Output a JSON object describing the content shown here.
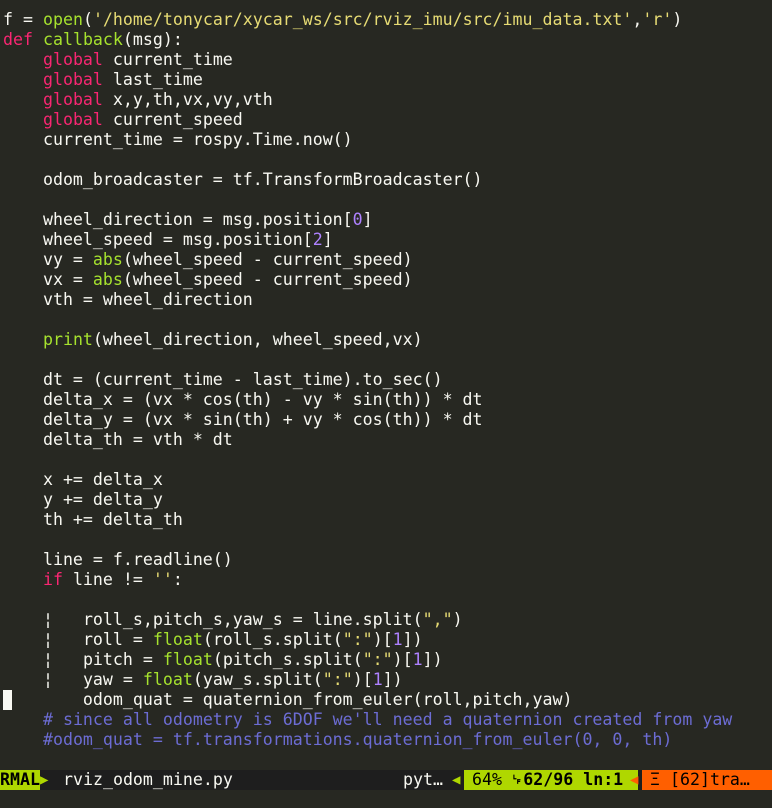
{
  "code_lines": [
    [
      [
        "t",
        "f = "
      ],
      [
        "bi",
        "open"
      ],
      [
        "t",
        "("
      ],
      [
        "st",
        "'/home/tonycar/xycar_ws/src/rviz_imu/src/imu_data.txt'"
      ],
      [
        "t",
        ","
      ],
      [
        "st",
        "'r'"
      ],
      [
        "t",
        ")"
      ]
    ],
    [
      [
        "kw",
        "def"
      ],
      [
        "t",
        " "
      ],
      [
        "bi",
        "callback"
      ],
      [
        "t",
        "(msg):"
      ]
    ],
    [
      [
        "t",
        "    "
      ],
      [
        "kw",
        "global"
      ],
      [
        "t",
        " current_time"
      ]
    ],
    [
      [
        "t",
        "    "
      ],
      [
        "kw",
        "global"
      ],
      [
        "t",
        " last_time"
      ]
    ],
    [
      [
        "t",
        "    "
      ],
      [
        "kw",
        "global"
      ],
      [
        "t",
        " x,y,th,vx,vy,vth"
      ]
    ],
    [
      [
        "t",
        "    "
      ],
      [
        "kw",
        "global"
      ],
      [
        "t",
        " current_speed"
      ]
    ],
    [
      [
        "t",
        "    current_time = rospy.Time.now()"
      ]
    ],
    [],
    [
      [
        "t",
        "    odom_broadcaster = tf.TransformBroadcaster()"
      ]
    ],
    [],
    [
      [
        "t",
        "    wheel_direction = msg.position["
      ],
      [
        "nm",
        "0"
      ],
      [
        "t",
        "]"
      ]
    ],
    [
      [
        "t",
        "    wheel_speed = msg.position["
      ],
      [
        "nm",
        "2"
      ],
      [
        "t",
        "]"
      ]
    ],
    [
      [
        "t",
        "    vy = "
      ],
      [
        "bi",
        "abs"
      ],
      [
        "t",
        "(wheel_speed - current_speed)"
      ]
    ],
    [
      [
        "t",
        "    vx = "
      ],
      [
        "bi",
        "abs"
      ],
      [
        "t",
        "(wheel_speed - current_speed)"
      ]
    ],
    [
      [
        "t",
        "    vth = wheel_direction"
      ]
    ],
    [],
    [
      [
        "t",
        "    "
      ],
      [
        "bi",
        "print"
      ],
      [
        "t",
        "(wheel_direction, wheel_speed,vx)"
      ]
    ],
    [],
    [
      [
        "t",
        "    dt = (current_time - last_time).to_sec()"
      ]
    ],
    [
      [
        "t",
        "    delta_x = (vx * cos(th) - vy * sin(th)) * dt"
      ]
    ],
    [
      [
        "t",
        "    delta_y = (vx * sin(th) + vy * cos(th)) * dt"
      ]
    ],
    [
      [
        "t",
        "    delta_th = vth * dt"
      ]
    ],
    [],
    [
      [
        "t",
        "    x += delta_x"
      ]
    ],
    [
      [
        "t",
        "    y += delta_y"
      ]
    ],
    [
      [
        "t",
        "    th += delta_th"
      ]
    ],
    [],
    [
      [
        "t",
        "    line = f.readline()"
      ]
    ],
    [
      [
        "t",
        "    "
      ],
      [
        "kw",
        "if"
      ],
      [
        "t",
        " line != "
      ],
      [
        "st",
        "''"
      ],
      [
        "t",
        ":"
      ]
    ],
    [],
    [
      [
        "t",
        "    "
      ],
      [
        "g",
        "¦"
      ],
      [
        "t",
        "   roll_s,pitch_s,yaw_s = line.split("
      ],
      [
        "st",
        "\",\""
      ],
      [
        "t",
        ")"
      ]
    ],
    [
      [
        "t",
        "    "
      ],
      [
        "g",
        "¦"
      ],
      [
        "t",
        "   roll = "
      ],
      [
        "bi",
        "float"
      ],
      [
        "t",
        "(roll_s.split("
      ],
      [
        "st",
        "\":\""
      ],
      [
        "t",
        ")["
      ],
      [
        "nm",
        "1"
      ],
      [
        "t",
        "])"
      ]
    ],
    [
      [
        "t",
        "    "
      ],
      [
        "g",
        "¦"
      ],
      [
        "t",
        "   pitch = "
      ],
      [
        "bi",
        "float"
      ],
      [
        "t",
        "(pitch_s.split("
      ],
      [
        "st",
        "\":\""
      ],
      [
        "t",
        ")["
      ],
      [
        "nm",
        "1"
      ],
      [
        "t",
        "])"
      ]
    ],
    [
      [
        "t",
        "    "
      ],
      [
        "g",
        "¦"
      ],
      [
        "t",
        "   yaw = "
      ],
      [
        "bi",
        "float"
      ],
      [
        "t",
        "(yaw_s.split("
      ],
      [
        "st",
        "\":\""
      ],
      [
        "t",
        ")["
      ],
      [
        "nm",
        "1"
      ],
      [
        "t",
        "])"
      ]
    ],
    [
      [
        "t",
        "        odom_quat = quaternion_from_euler(roll,pitch,yaw)"
      ]
    ],
    [
      [
        "t",
        "    "
      ],
      [
        "cm",
        "# since all odometry is 6DOF we'll need a quaternion created from yaw"
      ]
    ],
    [
      [
        "t",
        "    "
      ],
      [
        "cm",
        "#odom_quat = tf.transformations.quaternion_from_euler(0, 0, th)"
      ]
    ]
  ],
  "statusbar": {
    "mode": "RMAL",
    "mode_arrow": "▶",
    "filename": "rviz_odom_mine.py",
    "filetype": "pyt…",
    "left_arrow": "◀",
    "percent": "64%",
    "position": "␊62/96 ln:1",
    "warn_arrow": "◀",
    "warning": "Ξ [62]tra…"
  },
  "colors": {
    "background": "#272822",
    "keyword": "#f92672",
    "builtin": "#a6e22e",
    "string": "#e6db74",
    "number": "#ae81ff",
    "comment": "#6c6cd3",
    "mode_bg": "#afd700",
    "position_bg": "#afd700",
    "warning_bg": "#ff5f00"
  }
}
